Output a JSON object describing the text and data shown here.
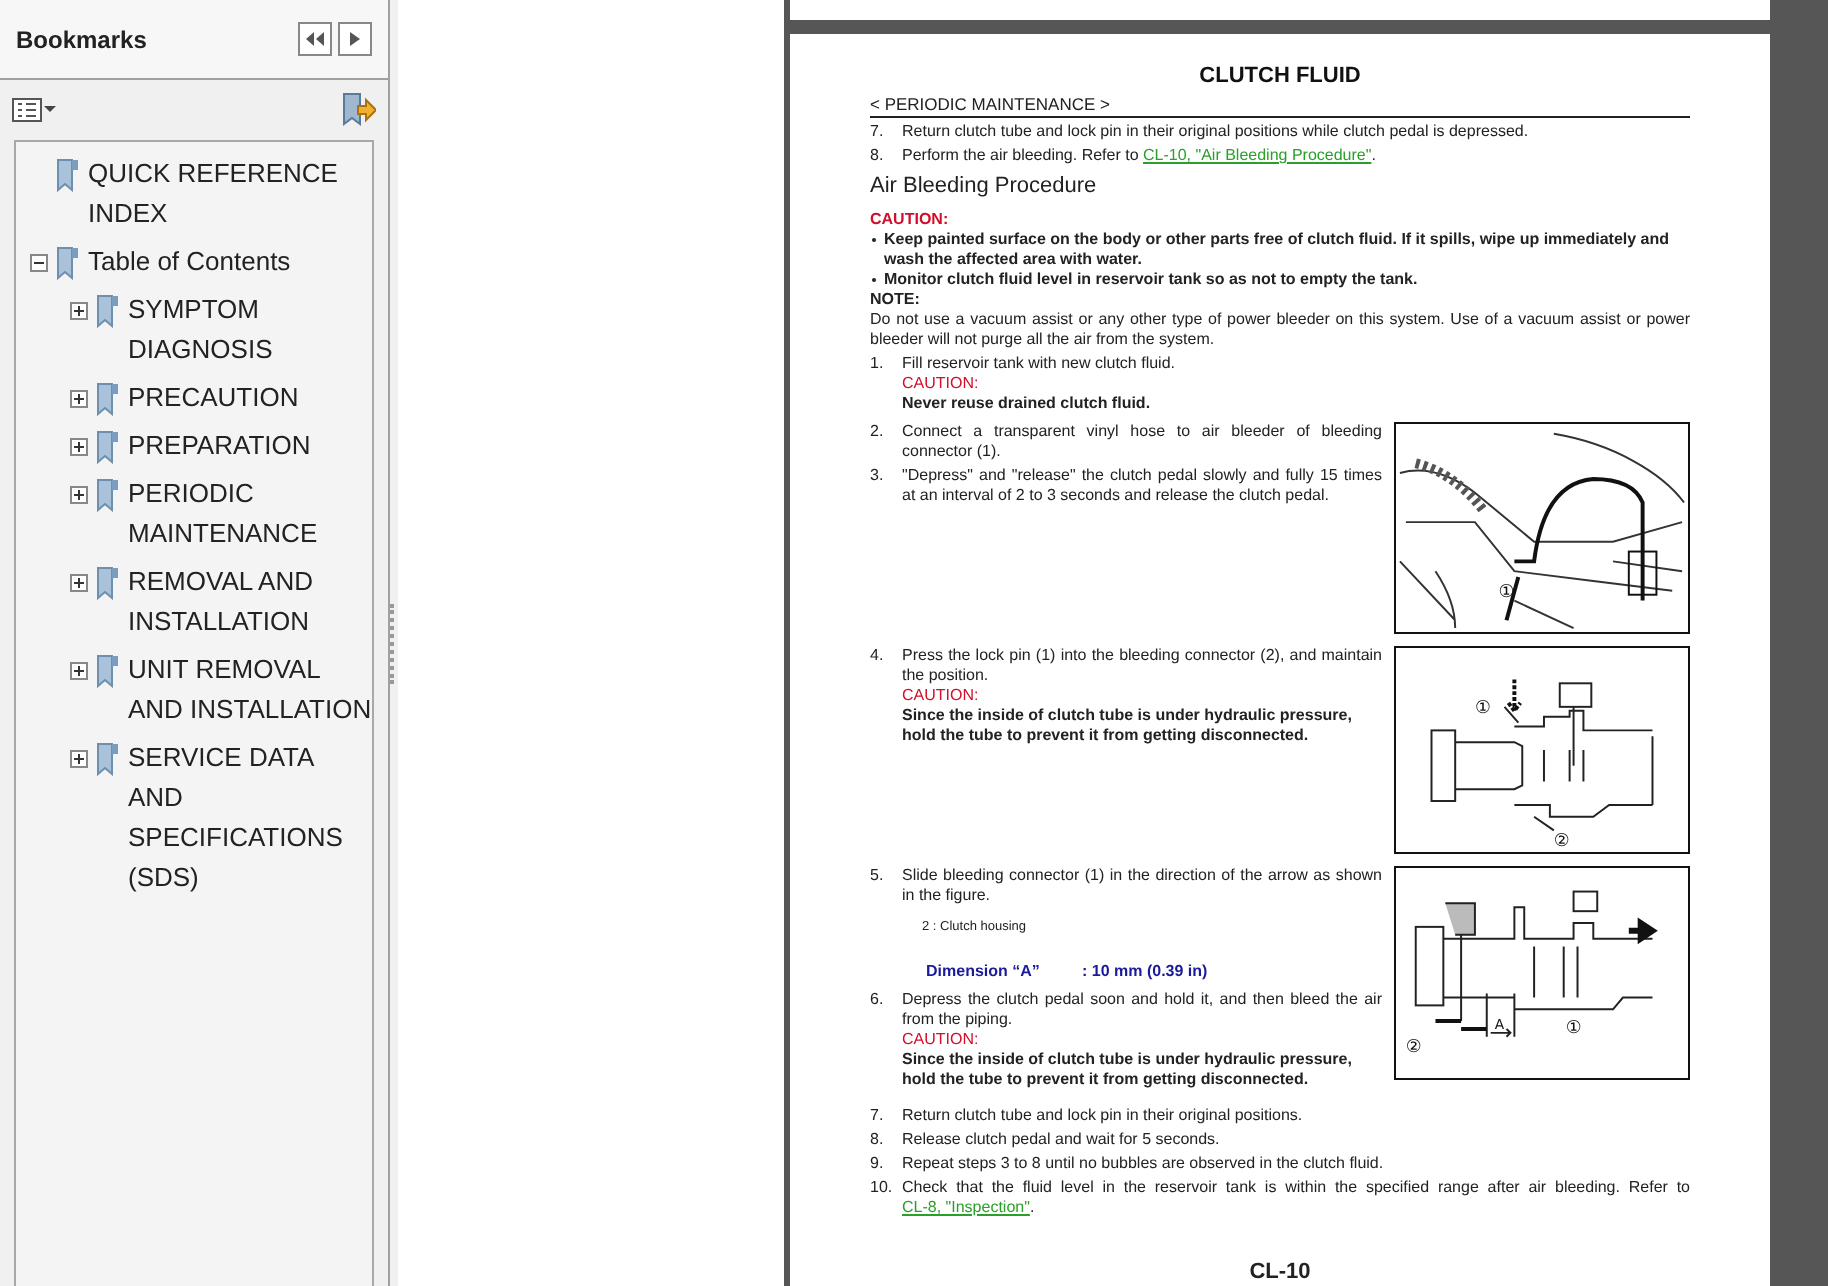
{
  "bookmarks": {
    "title": "Bookmarks",
    "items": [
      {
        "label": "QUICK REFERENCE INDEX"
      },
      {
        "label": "Table of Contents",
        "expanded": true,
        "children": [
          {
            "label": "SYMPTOM DIAGNOSIS",
            "expanded": false
          },
          {
            "label": "PRECAUTION",
            "expanded": false
          },
          {
            "label": "PREPARATION",
            "expanded": false
          },
          {
            "label": "PERIODIC MAINTENANCE",
            "expanded": false
          },
          {
            "label": "REMOVAL AND INSTALLATION",
            "expanded": false
          },
          {
            "label": "UNIT REMOVAL AND INSTALLATION",
            "expanded": false
          },
          {
            "label": "SERVICE DATA AND SPECIFICATIONS (SDS)",
            "expanded": false
          }
        ]
      }
    ]
  },
  "page": {
    "title": "CLUTCH FLUID",
    "breadcrumb": "< PERIODIC MAINTENANCE >",
    "intro_steps": [
      {
        "number": "7.",
        "text": "Return clutch tube and lock pin in their original positions while clutch pedal is depressed."
      },
      {
        "number": "8.",
        "text": "Perform the air bleeding. Refer to ",
        "link": "CL-10, \"Air Bleeding Procedure\"",
        "after": "."
      }
    ],
    "section_title": "Air Bleeding Procedure",
    "caution_label": "CAUTION:",
    "caution_bullets": [
      "Keep painted surface on the body or other parts free of clutch fluid. If it spills, wipe up immediately and wash the affected area with water.",
      "Monitor clutch fluid level in reservoir tank so as not to empty the tank."
    ],
    "note_label": "NOTE:",
    "note_text": "Do not use a vacuum assist or any other type of power bleeder on this system. Use of a vacuum assist or power bleeder will not purge all the air from the system.",
    "blocks": [
      {
        "steps": [
          {
            "number": "1.",
            "text": "Fill reservoir tank with new clutch fluid.",
            "caution": {
              "label": "CAUTION:",
              "text": "Never reuse drained clutch fluid."
            }
          }
        ]
      },
      {
        "figure": {
          "kind": "bleeder-view",
          "callouts": [
            "①"
          ]
        },
        "steps": [
          {
            "number": "2.",
            "text": "Connect a transparent vinyl hose to air bleeder of bleeding connector (1)."
          },
          {
            "number": "3.",
            "text": "\"Depress\" and \"release\" the clutch pedal slowly and fully 15 times at an interval of 2 to 3 seconds and release the clutch pedal."
          }
        ]
      },
      {
        "figure": {
          "kind": "connector-press",
          "callouts": [
            "①",
            "②"
          ]
        },
        "steps": [
          {
            "number": "4.",
            "text": "Press the lock pin (1) into the bleeding connector (2), and maintain the position.",
            "caution": {
              "label": "CAUTION:",
              "text": "Since the inside of clutch tube is under hydraulic pressure, hold the tube to prevent it from getting disconnected."
            }
          }
        ]
      },
      {
        "figure": {
          "kind": "connector-slide",
          "callouts": [
            "②",
            "A",
            "①"
          ]
        },
        "steps": [
          {
            "number": "5.",
            "text": "Slide bleeding connector (1) in the direction of the arrow as shown in the figure.",
            "legend": "2    : Clutch housing",
            "dimension_label": "Dimension “A”",
            "dimension_value": ": 10 mm (0.39 in)"
          },
          {
            "number": "6.",
            "text": "Depress the clutch pedal soon and hold it, and then bleed the air from the piping.",
            "caution": {
              "label": "CAUTION:",
              "text": "Since the inside of clutch tube is under hydraulic pressure, hold the tube to prevent it from getting disconnected."
            }
          }
        ]
      },
      {
        "steps": [
          {
            "number": "7.",
            "text": "Return clutch tube and lock pin in their original positions."
          },
          {
            "number": "8.",
            "text": "Release clutch pedal and wait for 5 seconds."
          },
          {
            "number": "9.",
            "text": "Repeat steps 3 to 8 until no bubbles are observed in the clutch fluid."
          },
          {
            "number": "10.",
            "text": "Check that the fluid level in the reservoir tank is within the specified range after air bleeding. Refer to ",
            "link": "CL-8, \"Inspection\"",
            "after": "."
          }
        ]
      }
    ],
    "footer": "CL-10"
  }
}
